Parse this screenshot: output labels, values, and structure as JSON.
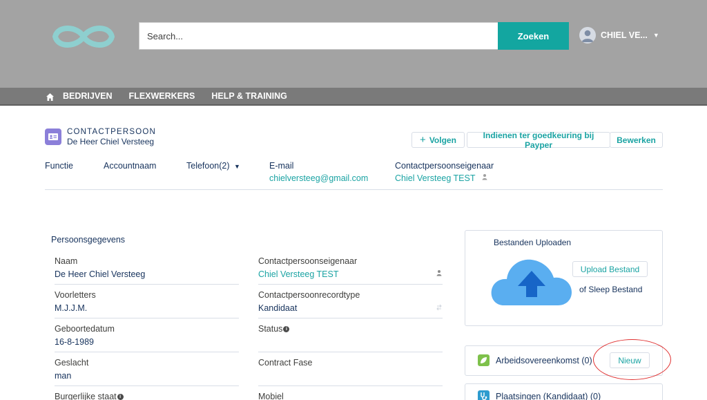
{
  "header": {
    "search_placeholder": "Search...",
    "search_button": "Zoeken",
    "user_name": "CHIEL VE...",
    "icons": {
      "logo": "infinity-logo",
      "avatar": "user-avatar-icon",
      "caret": "caret-down-icon"
    },
    "colors": {
      "background": "#a3a3a3",
      "accent": "#13a6a0"
    }
  },
  "nav": {
    "items": [
      "BEDRIJVEN",
      "FLEXWERKERS",
      "HELP & TRAINING"
    ],
    "home_icon": "home-icon",
    "background": "#7a7a7a"
  },
  "record": {
    "type": "CONTACTPERSOON",
    "name": "De Heer Chiel Versteeg",
    "icon": "contact-card-icon",
    "icon_color": "#8b7fd9",
    "actions": {
      "follow": "Volgen",
      "submit": "Indienen ter goedkeuring bij Payper",
      "edit": "Bewerken"
    }
  },
  "highlights": {
    "functie": "Functie",
    "accountnaam": "Accountnaam",
    "telefoon": "Telefoon(2)",
    "email_label": "E-mail",
    "email_value": "chielversteeg@gmail.com",
    "owner_label": "Contactpersoonseigenaar",
    "owner_value": "Chiel Versteeg TEST"
  },
  "details": {
    "section_title": "Persoonsgegevens",
    "left": [
      {
        "label": "Naam",
        "value": "De Heer Chiel Versteeg"
      },
      {
        "label": "Voorletters",
        "value": "M.J.J.M."
      },
      {
        "label": "Geboortedatum",
        "value": "16-8-1989"
      },
      {
        "label": "Geslacht",
        "value": "man"
      },
      {
        "label": "Burgerlijke staat",
        "value": ""
      }
    ],
    "right": [
      {
        "label": "Contactpersoonseigenaar",
        "value": "Chiel Versteeg TEST"
      },
      {
        "label": "Contactpersoonrecordtype",
        "value": "Kandidaat"
      },
      {
        "label": "Status",
        "value": ""
      },
      {
        "label": "Contract Fase",
        "value": ""
      },
      {
        "label": "Mobiel",
        "value": ""
      }
    ]
  },
  "upload": {
    "title": "Bestanden Uploaden",
    "button": "Upload Bestand",
    "drop_text": "of Sleep Bestand",
    "cloud_color": "#5aaef0"
  },
  "related": [
    {
      "title": "Arbeidsovereenkomst (0)",
      "button": "Nieuw",
      "icon_color": "#7ec14b"
    },
    {
      "title": "Plaatsingen (Kandidaat) (0)",
      "icon_color": "#2e9ccf"
    }
  ],
  "annotation": {
    "color": "#e03030"
  }
}
